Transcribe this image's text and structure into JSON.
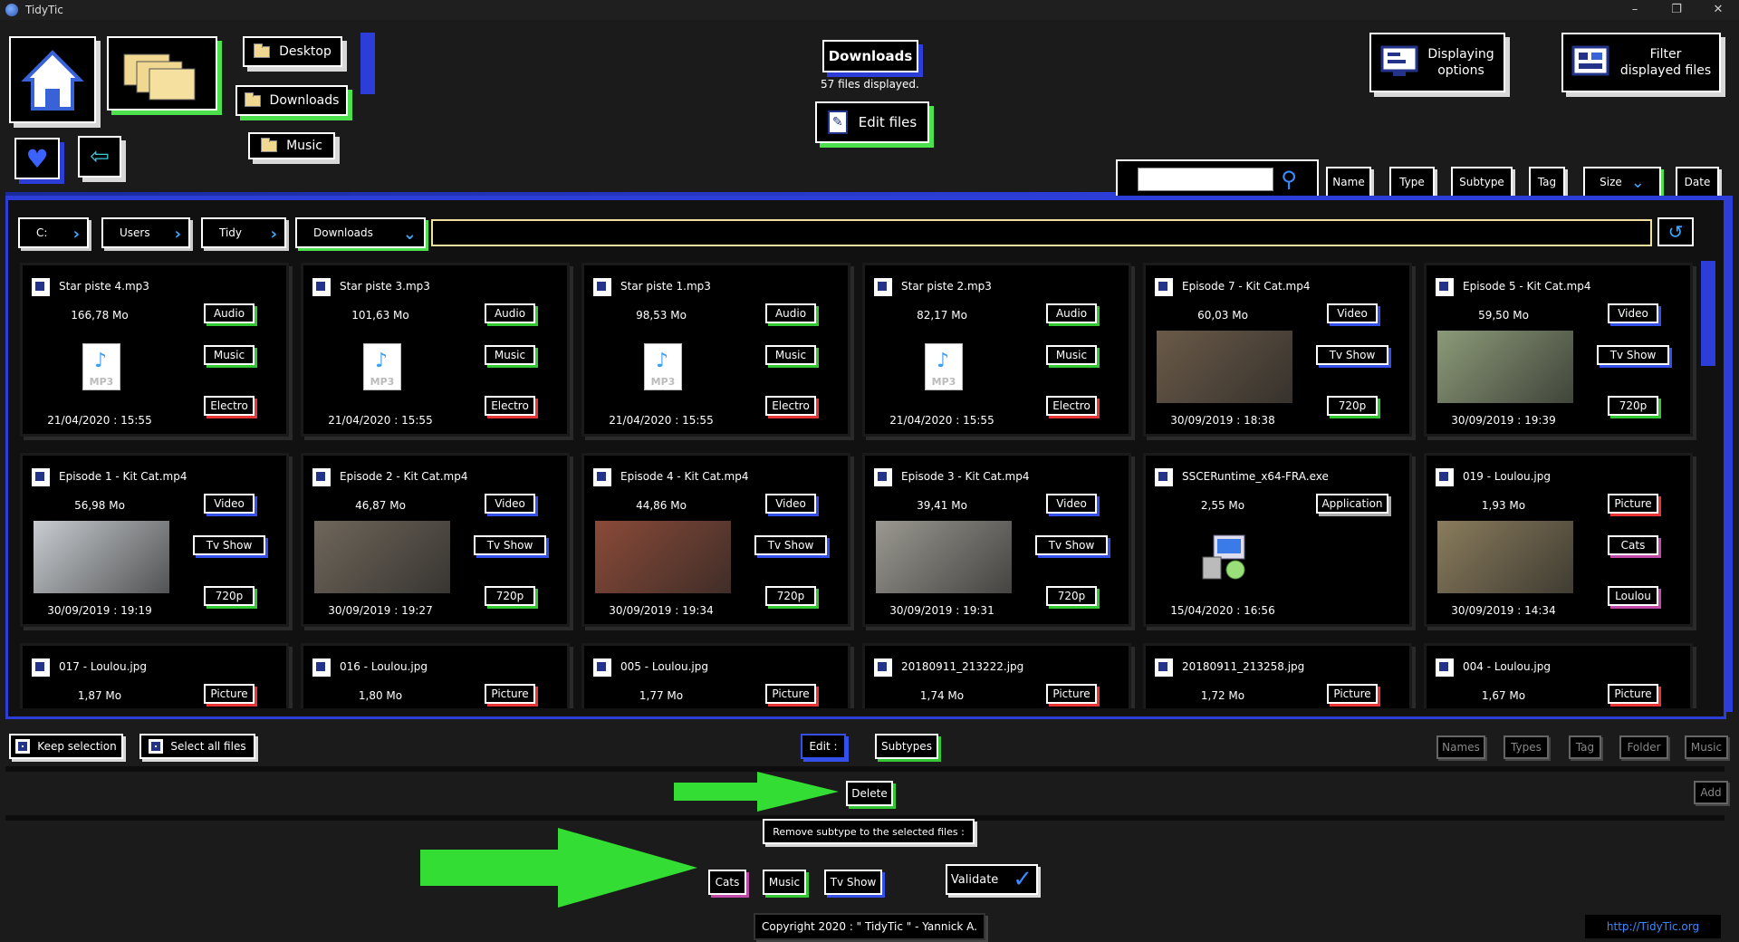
{
  "window": {
    "title": "TidyTic",
    "minimize": "–",
    "restore": "❐",
    "close": "✕"
  },
  "top": {
    "shortcuts": [
      "Desktop",
      "Downloads",
      "Music"
    ],
    "current_folder": "Downloads",
    "files_displayed": "57 files displayed.",
    "edit_files": "Edit files",
    "displaying_options": [
      "Displaying",
      "options"
    ],
    "filter_files": [
      "Filter",
      "displayed files"
    ]
  },
  "sort": {
    "search_placeholder": "",
    "buttons": [
      "Name",
      "Type",
      "Subtype",
      "Tag",
      "Size",
      "Date"
    ]
  },
  "breadcrumb": [
    "C:",
    "Users",
    "Tidy",
    "Downloads"
  ],
  "files": [
    {
      "name": "Star piste 4.mp3",
      "size": "166,78 Mo",
      "date": "21/04/2020 : 15:55",
      "kind": "mp3",
      "tags": [
        {
          "t": "Audio",
          "c": "green"
        },
        {
          "t": "Music",
          "c": "green"
        },
        {
          "t": "Electro",
          "c": "red"
        }
      ]
    },
    {
      "name": "Star piste 3.mp3",
      "size": "101,63 Mo",
      "date": "21/04/2020 : 15:55",
      "kind": "mp3",
      "tags": [
        {
          "t": "Audio",
          "c": "green"
        },
        {
          "t": "Music",
          "c": "green"
        },
        {
          "t": "Electro",
          "c": "red"
        }
      ]
    },
    {
      "name": "Star piste 1.mp3",
      "size": "98,53 Mo",
      "date": "21/04/2020 : 15:55",
      "kind": "mp3",
      "tags": [
        {
          "t": "Audio",
          "c": "green"
        },
        {
          "t": "Music",
          "c": "green"
        },
        {
          "t": "Electro",
          "c": "red"
        }
      ]
    },
    {
      "name": "Star piste 2.mp3",
      "size": "82,17 Mo",
      "date": "21/04/2020 : 15:55",
      "kind": "mp3",
      "tags": [
        {
          "t": "Audio",
          "c": "green"
        },
        {
          "t": "Music",
          "c": "green"
        },
        {
          "t": "Electro",
          "c": "red"
        }
      ]
    },
    {
      "name": "Episode 7 - Kit Cat.mp4",
      "size": "60,03 Mo",
      "date": "30/09/2019 : 18:38",
      "kind": "photo",
      "color": "#6a5a48",
      "tags": [
        {
          "t": "Video",
          "c": "blue"
        },
        {
          "t": "Tv Show",
          "c": "blue",
          "w": true
        },
        {
          "t": "720p",
          "c": "green"
        }
      ]
    },
    {
      "name": "Episode 5 - Kit Cat.mp4",
      "size": "59,50 Mo",
      "date": "30/09/2019 : 19:39",
      "kind": "photo",
      "color": "#8c9a78",
      "tags": [
        {
          "t": "Video",
          "c": "blue"
        },
        {
          "t": "Tv Show",
          "c": "blue",
          "w": true
        },
        {
          "t": "720p",
          "c": "green"
        }
      ]
    },
    {
      "name": "Episode 1 - Kit Cat.mp4",
      "size": "56,98 Mo",
      "date": "30/09/2019 : 19:19",
      "kind": "photo",
      "color": "#c8ccd0",
      "tags": [
        {
          "t": "Video",
          "c": "blue"
        },
        {
          "t": "Tv Show",
          "c": "blue",
          "w": true
        },
        {
          "t": "720p",
          "c": "green"
        }
      ]
    },
    {
      "name": "Episode 2 - Kit Cat.mp4",
      "size": "46,87 Mo",
      "date": "30/09/2019 : 19:27",
      "kind": "photo",
      "color": "#6f665a",
      "tags": [
        {
          "t": "Video",
          "c": "blue"
        },
        {
          "t": "Tv Show",
          "c": "blue",
          "w": true
        },
        {
          "t": "720p",
          "c": "green"
        }
      ]
    },
    {
      "name": "Episode 4 - Kit Cat.mp4",
      "size": "44,86 Mo",
      "date": "30/09/2019 : 19:34",
      "kind": "photo",
      "color": "#8a4a38",
      "tags": [
        {
          "t": "Video",
          "c": "blue"
        },
        {
          "t": "Tv Show",
          "c": "blue",
          "w": true
        },
        {
          "t": "720p",
          "c": "green"
        }
      ]
    },
    {
      "name": "Episode 3 - Kit Cat.mp4",
      "size": "39,41 Mo",
      "date": "30/09/2019 : 19:31",
      "kind": "photo",
      "color": "#9a9890",
      "tags": [
        {
          "t": "Video",
          "c": "blue"
        },
        {
          "t": "Tv Show",
          "c": "blue",
          "w": true
        },
        {
          "t": "720p",
          "c": "green"
        }
      ]
    },
    {
      "name": "SSCERuntime_x64-FRA.exe",
      "size": "2,55 Mo",
      "date": "15/04/2020 : 16:56",
      "kind": "exe",
      "tags": [
        {
          "t": "Application",
          "c": "gray",
          "w": true
        }
      ]
    },
    {
      "name": "019 - Loulou.jpg",
      "size": "1,93 Mo",
      "date": "30/09/2019 : 14:34",
      "kind": "photo",
      "color": "#8a7c5c",
      "tags": [
        {
          "t": "Picture",
          "c": "red"
        },
        {
          "t": "Cats",
          "c": "pink"
        },
        {
          "t": "Loulou",
          "c": "pink"
        }
      ]
    },
    {
      "name": "017 - Loulou.jpg",
      "size": "1,87 Mo",
      "date": "",
      "kind": "none",
      "tags": [
        {
          "t": "Picture",
          "c": "red"
        }
      ]
    },
    {
      "name": "016 - Loulou.jpg",
      "size": "1,80 Mo",
      "date": "",
      "kind": "none",
      "tags": [
        {
          "t": "Picture",
          "c": "red"
        }
      ]
    },
    {
      "name": "005 - Loulou.jpg",
      "size": "1,77 Mo",
      "date": "",
      "kind": "none",
      "tags": [
        {
          "t": "Picture",
          "c": "red"
        }
      ]
    },
    {
      "name": "20180911_213222.jpg",
      "size": "1,74 Mo",
      "date": "",
      "kind": "none",
      "tags": [
        {
          "t": "Picture",
          "c": "red"
        }
      ]
    },
    {
      "name": "20180911_213258.jpg",
      "size": "1,72 Mo",
      "date": "",
      "kind": "none",
      "tags": [
        {
          "t": "Picture",
          "c": "red"
        }
      ]
    },
    {
      "name": "004 - Loulou.jpg",
      "size": "1,67 Mo",
      "date": "",
      "kind": "none",
      "tags": [
        {
          "t": "Picture",
          "c": "red"
        }
      ]
    }
  ],
  "bottom": {
    "keep_selection": "Keep selection",
    "select_all": "Select all files",
    "edit": "Edit :",
    "subtypes": "Subtypes",
    "right_tools": [
      "Names",
      "Types",
      "Tag",
      "Folder",
      "Music"
    ],
    "delete": "Delete",
    "add": "Add",
    "remove_label": "Remove subtype to the selected files :",
    "subtype_chips": [
      {
        "t": "Cats",
        "c": "pink"
      },
      {
        "t": "Music",
        "c": "green"
      },
      {
        "t": "Tv Show",
        "c": "blue"
      }
    ],
    "validate": "Validate"
  },
  "footer": {
    "copyright": "Copyright 2020 : \" TidyTic \" - Yannick A.",
    "link": "http://TidyTic.org"
  },
  "colors": {
    "accent_blue": "#2d3ed8",
    "accent_green": "#4ce04c",
    "arrow_green": "#33dd33",
    "bg": "#1b1b1b"
  }
}
